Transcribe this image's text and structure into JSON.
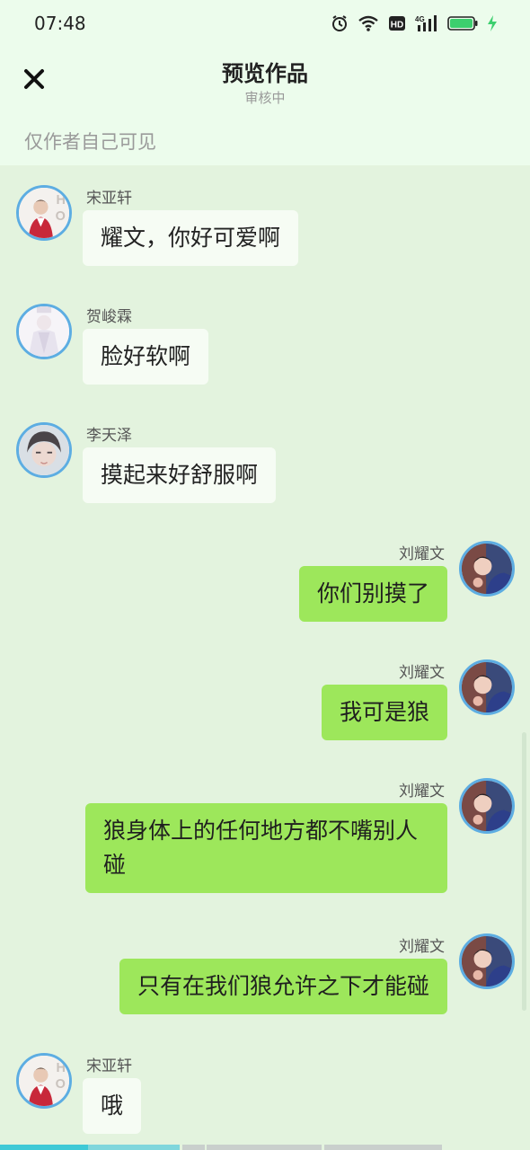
{
  "status_bar": {
    "time": "07:48",
    "icons": [
      "alarm-icon",
      "wifi-icon",
      "hd-icon",
      "signal-4g-icon",
      "battery-icon",
      "charging-icon"
    ],
    "hd_label": "HD",
    "net_label": "4G"
  },
  "header": {
    "close_icon": "close-icon",
    "title": "预览作品",
    "subtitle": "审核中",
    "visibility_note": "仅作者自己可见"
  },
  "messages": [
    {
      "side": "left",
      "sender": "宋亚轩",
      "text": "耀文，你好可爱啊"
    },
    {
      "side": "left",
      "sender": "贺峻霖",
      "text": "脸好软啊"
    },
    {
      "side": "left",
      "sender": "李天泽",
      "text": "摸起来好舒服啊"
    },
    {
      "side": "right",
      "sender": "刘耀文",
      "text": "你们别摸了"
    },
    {
      "side": "right",
      "sender": "刘耀文",
      "text": "我可是狼"
    },
    {
      "side": "right",
      "sender": "刘耀文",
      "text": "狼身体上的任何地方都不嘴别人碰"
    },
    {
      "side": "right",
      "sender": "刘耀文",
      "text": "只有在我们狼允许之下才能碰"
    },
    {
      "side": "left",
      "sender": "宋亚轩",
      "text": "哦"
    }
  ],
  "colors": {
    "background": "#e3f3de",
    "header_bg": "#ecfcec",
    "left_bubble": "#f6fcf4",
    "right_bubble": "#9de75b",
    "avatar_border": "#5dade2",
    "battery": "#3ccf6e",
    "progress": "#3ec9d6"
  }
}
